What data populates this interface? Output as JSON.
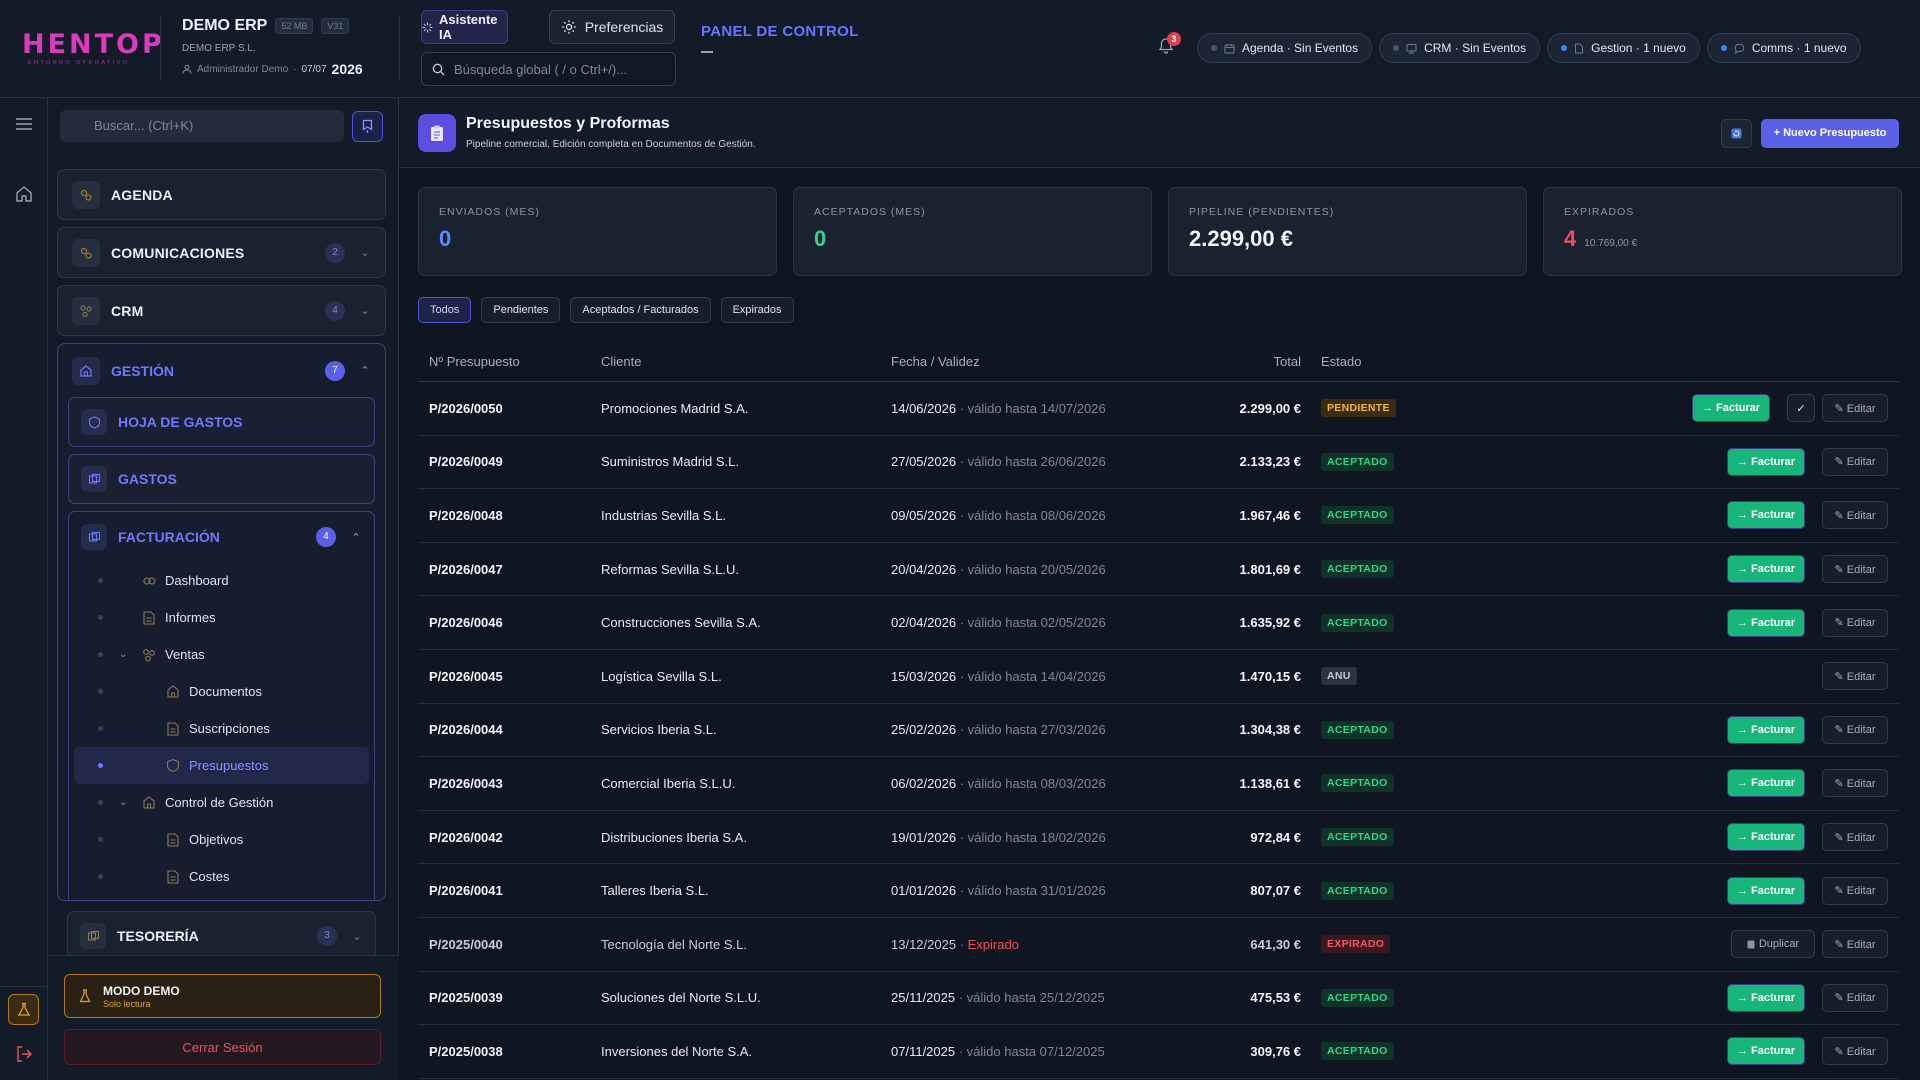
{
  "header": {
    "logo_text": "HENTOP",
    "logo_sub": "ENTORNO OPERATIVO",
    "company_name": "DEMO ERP",
    "size_badge": "52 MB",
    "version_badge": "V31",
    "company_legal": "DEMO ERP S.L.",
    "user": "Administrador Demo",
    "date": "07/07",
    "year": "2026",
    "ai_button": "Asistente IA",
    "prefs_button": "Preferencias",
    "search_placeholder": "Búsqueda global ( / o Ctrl+/)...",
    "panel_title": "PANEL DE CONTROL",
    "notif_count": "3",
    "status_pills": [
      {
        "label": "Agenda · Sin Eventos",
        "icon": "calendar-icon",
        "active": false
      },
      {
        "label": "CRM · Sin Eventos",
        "icon": "crm-icon",
        "active": false
      },
      {
        "label": "Gestion · 1 nuevo",
        "icon": "document-icon",
        "active": true
      },
      {
        "label": "Comms · 1 nuevo",
        "icon": "chat-icon",
        "active": true
      }
    ]
  },
  "sidebar": {
    "search_placeholder": "Buscar... (Ctrl+K)",
    "agenda": "AGENDA",
    "comunicaciones": {
      "label": "COMUNICACIONES",
      "badge": "2"
    },
    "crm": {
      "label": "CRM",
      "badge": "4"
    },
    "gestion": {
      "label": "GESTIÓN",
      "badge": "7"
    },
    "hoja_gastos": "HOJA DE GASTOS",
    "gastos": "GASTOS",
    "facturacion": {
      "label": "FACTURACIÓN",
      "badge": "4"
    },
    "tree": [
      {
        "label": "Dashboard",
        "level": 1
      },
      {
        "label": "Informes",
        "level": 1
      },
      {
        "label": "Ventas",
        "level": 1
      },
      {
        "label": "Documentos",
        "level": 2
      },
      {
        "label": "Suscripciones",
        "level": 2
      },
      {
        "label": "Presupuestos",
        "level": 2
      },
      {
        "label": "Control de Gestión",
        "level": 1
      },
      {
        "label": "Objetivos",
        "level": 2
      },
      {
        "label": "Costes",
        "level": 2
      }
    ],
    "tesoreria": {
      "label": "TESORERÍA",
      "badge": "3"
    },
    "demo_title": "MODO DEMO",
    "demo_sub": "Solo lectura",
    "logout": "Cerrar Sesión"
  },
  "page": {
    "title": "Presupuestos y Proformas",
    "subtitle": "Pipeline comercial. Edición completa en Documentos de Gestión.",
    "new_button": "+ Nuevo Presupuesto",
    "kpis": [
      {
        "label": "ENVIADOS (MES)",
        "value": "0",
        "color": "#5b8cff",
        "sub": ""
      },
      {
        "label": "ACEPTADOS (MES)",
        "value": "0",
        "color": "#2fd68c",
        "sub": ""
      },
      {
        "label": "PIPELINE (PENDIENTES)",
        "value": "2.299,00 €",
        "color": "#f2f5fa",
        "sub": ""
      },
      {
        "label": "EXPIRADOS",
        "value": "4",
        "color": "#ef4f5e",
        "sub": "10.769,00 €"
      }
    ],
    "filters": [
      "Todos",
      "Pendientes",
      "Aceptados / Facturados",
      "Expirados"
    ],
    "columns": {
      "num": "Nº Presupuesto",
      "client": "Cliente",
      "date": "Fecha / Validez",
      "total": "Total",
      "status": "Estado"
    },
    "actions": {
      "invoice": "→ Facturar",
      "check": "✓",
      "edit": "✎ Editar",
      "duplicate": "Duplicar"
    },
    "rows": [
      {
        "num": "P/2026/0050",
        "client": "Promociones Madrid S.A.",
        "date": "14/06/2026",
        "valid": " · válido hasta 14/07/2026",
        "total": "2.299,00 €",
        "status": "PENDIENTE",
        "kind": "pend"
      },
      {
        "num": "P/2026/0049",
        "client": "Suministros Madrid S.L.",
        "date": "27/05/2026",
        "valid": " · válido hasta 26/06/2026",
        "total": "2.133,23 €",
        "status": "ACEPTADO",
        "kind": "acc"
      },
      {
        "num": "P/2026/0048",
        "client": "Industrias Sevilla S.L.",
        "date": "09/05/2026",
        "valid": " · válido hasta 08/06/2026",
        "total": "1.967,46 €",
        "status": "ACEPTADO",
        "kind": "acc"
      },
      {
        "num": "P/2026/0047",
        "client": "Reformas Sevilla S.L.U.",
        "date": "20/04/2026",
        "valid": " · válido hasta 20/05/2026",
        "total": "1.801,69 €",
        "status": "ACEPTADO",
        "kind": "acc"
      },
      {
        "num": "P/2026/0046",
        "client": "Construcciones Sevilla S.A.",
        "date": "02/04/2026",
        "valid": " · válido hasta 02/05/2026",
        "total": "1.635,92 €",
        "status": "ACEPTADO",
        "kind": "acc"
      },
      {
        "num": "P/2026/0045",
        "client": "Logística Sevilla S.L.",
        "date": "15/03/2026",
        "valid": " · válido hasta 14/04/2026",
        "total": "1.470,15 €",
        "status": "ANU",
        "kind": "anu"
      },
      {
        "num": "P/2026/0044",
        "client": "Servicios Iberia S.L.",
        "date": "25/02/2026",
        "valid": " · válido hasta 27/03/2026",
        "total": "1.304,38 €",
        "status": "ACEPTADO",
        "kind": "acc"
      },
      {
        "num": "P/2026/0043",
        "client": "Comercial Iberia S.L.U.",
        "date": "06/02/2026",
        "valid": " · válido hasta 08/03/2026",
        "total": "1.138,61 €",
        "status": "ACEPTADO",
        "kind": "acc"
      },
      {
        "num": "P/2026/0042",
        "client": "Distribuciones Iberia S.A.",
        "date": "19/01/2026",
        "valid": " · válido hasta 18/02/2026",
        "total": "972,84 €",
        "status": "ACEPTADO",
        "kind": "acc"
      },
      {
        "num": "P/2026/0041",
        "client": "Talleres Iberia S.L.",
        "date": "01/01/2026",
        "valid": " · válido hasta 31/01/2026",
        "total": "807,07 €",
        "status": "ACEPTADO",
        "kind": "acc"
      },
      {
        "num": "P/2025/0040",
        "client": "Tecnología del Norte S.L.",
        "date": "13/12/2025",
        "valid": " · Expirado",
        "total": "641,30 €",
        "status": "EXPIRADO",
        "kind": "exp"
      },
      {
        "num": "P/2025/0039",
        "client": "Soluciones del Norte S.L.U.",
        "date": "25/11/2025",
        "valid": " · válido hasta 25/12/2025",
        "total": "475,53 €",
        "status": "ACEPTADO",
        "kind": "acc"
      },
      {
        "num": "P/2025/0038",
        "client": "Inversiones del Norte S.A.",
        "date": "07/11/2025",
        "valid": " · válido hasta 07/12/2025",
        "total": "309,76 €",
        "status": "ACEPTADO",
        "kind": "acc"
      }
    ]
  }
}
